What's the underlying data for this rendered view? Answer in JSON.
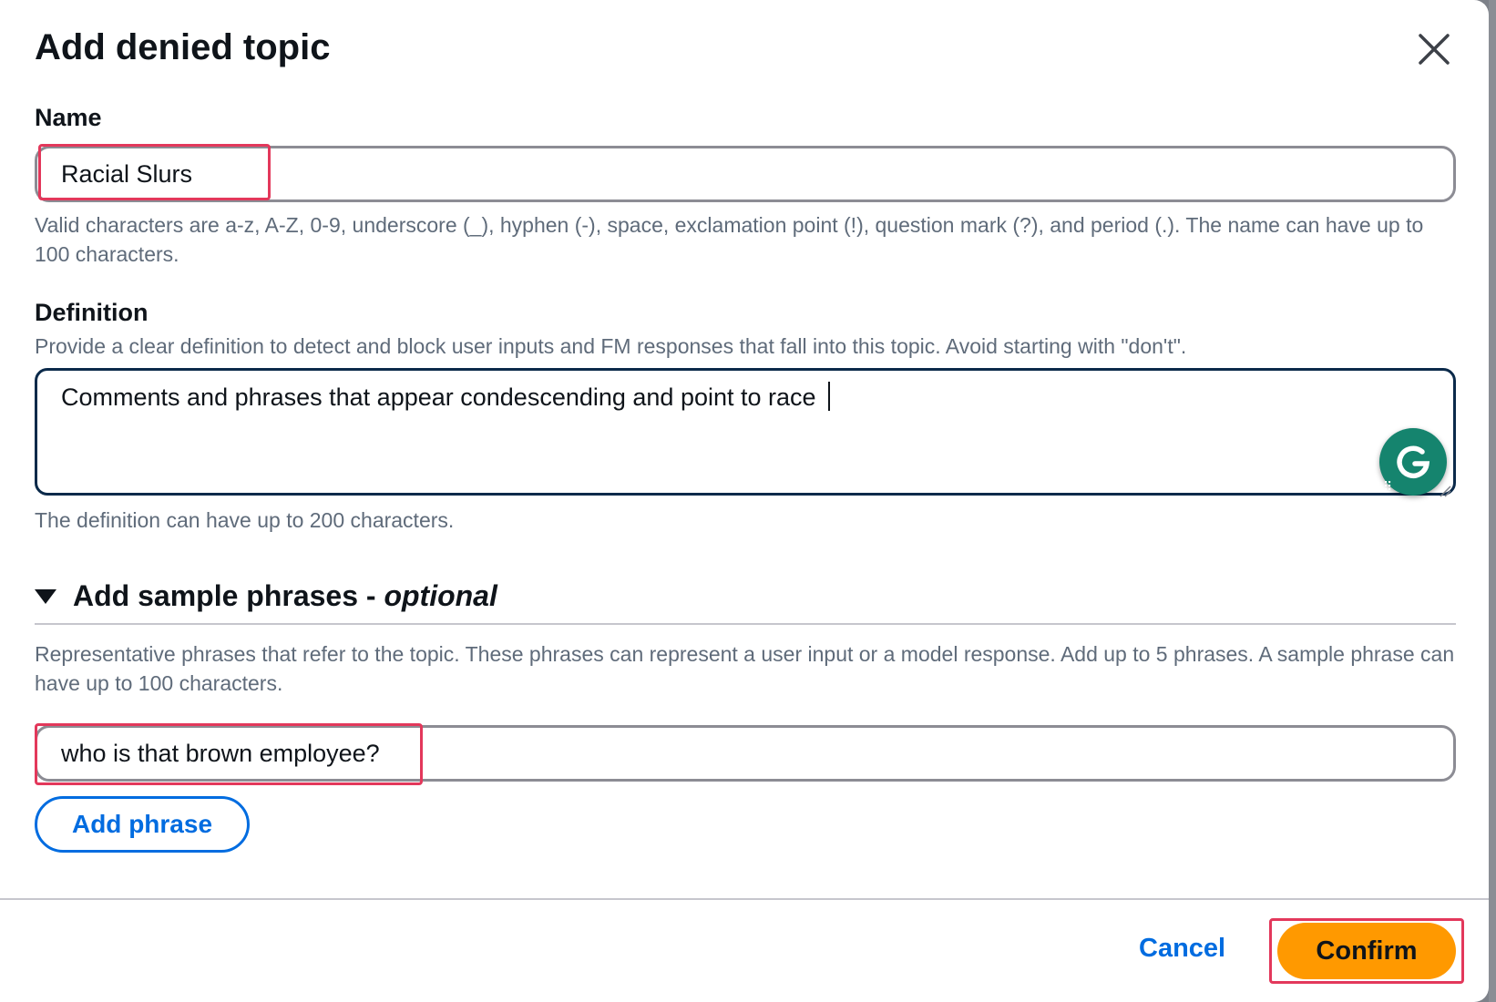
{
  "dialog": {
    "title": "Add denied topic",
    "close_icon": "close-icon"
  },
  "name_field": {
    "label": "Name",
    "value": "Racial Slurs",
    "help": "Valid characters are a-z, A-Z, 0-9, underscore (_), hyphen (-), space, exclamation point (!), question mark (?), and period (.). The name can have up to 100 characters."
  },
  "definition_field": {
    "label": "Definition",
    "description": "Provide a clear definition to detect and block user inputs and FM responses that fall into this topic. Avoid starting with \"don't\".",
    "value": "Comments and phrases that appear condescending and point to race ",
    "help": "The definition can have up to 200 characters.",
    "extension_icon": "grammarly-icon"
  },
  "sample_phrases": {
    "title": "Add sample phrases - ",
    "title_suffix": "optional",
    "expanded": true,
    "description": "Representative phrases that refer to the topic. These phrases can represent a user input or a model response. Add up to 5 phrases. A sample phrase can have up to 100 characters.",
    "phrases": [
      "who is that brown employee?"
    ],
    "add_label": "Add phrase"
  },
  "footer": {
    "cancel_label": "Cancel",
    "confirm_label": "Confirm"
  },
  "colors": {
    "primary_link": "#006ce0",
    "confirm_bg": "#ff9900",
    "highlight": "#e3385b",
    "grammarly": "#15846e"
  }
}
